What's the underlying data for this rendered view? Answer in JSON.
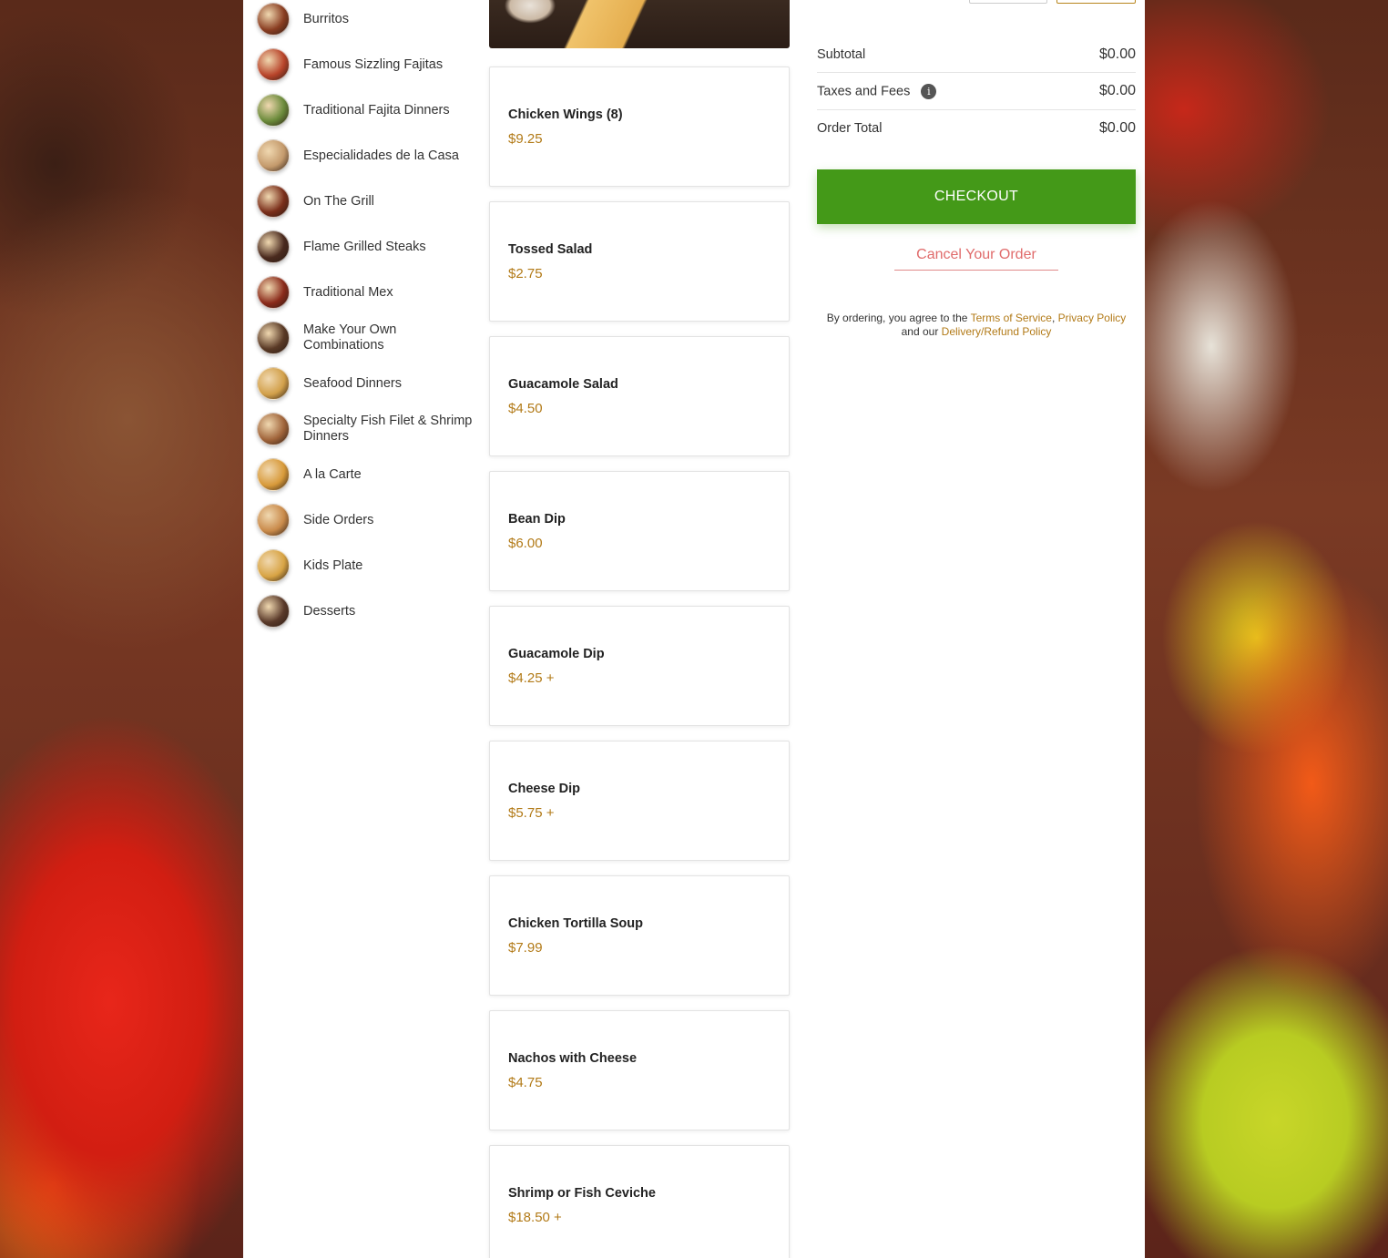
{
  "categories": [
    {
      "label": "Burritos",
      "thumb": "#8a3e22"
    },
    {
      "label": "Famous Sizzling Fajitas",
      "thumb": "#b8442a"
    },
    {
      "label": "Traditional Fajita Dinners",
      "thumb": "#6a8a3a"
    },
    {
      "label": "Especialidades de la Casa",
      "thumb": "#c49a6c"
    },
    {
      "label": "On The Grill",
      "thumb": "#7a2e1a"
    },
    {
      "label": "Flame Grilled Steaks",
      "thumb": "#4a2a1e"
    },
    {
      "label": "Traditional Mex",
      "thumb": "#8a2a1a"
    },
    {
      "label": "Make Your Own Combinations",
      "thumb": "#5a3a26"
    },
    {
      "label": "Seafood Dinners",
      "thumb": "#d2a04a"
    },
    {
      "label": "Specialty Fish Filet & Shrimp Dinners",
      "thumb": "#a0643a"
    },
    {
      "label": "A la Carte",
      "thumb": "#d89a3a"
    },
    {
      "label": "Side Orders",
      "thumb": "#c98a4a"
    },
    {
      "label": "Kids Plate",
      "thumb": "#d8a444"
    },
    {
      "label": "Desserts",
      "thumb": "#5a3a2a"
    }
  ],
  "menu_items": [
    {
      "name": "Chicken Wings (8)",
      "price": "$9.25"
    },
    {
      "name": "Tossed Salad",
      "price": "$2.75"
    },
    {
      "name": "Guacamole Salad",
      "price": "$4.50"
    },
    {
      "name": "Bean Dip",
      "price": "$6.00"
    },
    {
      "name": "Guacamole Dip",
      "price": "$4.25 +"
    },
    {
      "name": "Cheese Dip",
      "price": "$5.75 +"
    },
    {
      "name": "Chicken Tortilla Soup",
      "price": "$7.99"
    },
    {
      "name": "Nachos with Cheese",
      "price": "$4.75"
    },
    {
      "name": "Shrimp or Fish Ceviche",
      "price": "$18.50 +"
    }
  ],
  "summary": {
    "subtotal_label": "Subtotal",
    "subtotal_value": "$0.00",
    "taxes_label": "Taxes and Fees",
    "taxes_icon": "i",
    "taxes_value": "$0.00",
    "total_label": "Order Total",
    "total_value": "$0.00",
    "checkout_label": "CHECKOUT",
    "cancel_label": "Cancel Your Order"
  },
  "legal": {
    "prefix": "By ordering, you agree to the ",
    "terms": "Terms of Service",
    "sep1": ", ",
    "privacy": "Privacy Policy",
    "sep2": " and our ",
    "refund": "Delivery/Refund Policy"
  },
  "colors": {
    "accent": "#b27a17",
    "checkout": "#449918",
    "cancel": "#e06b6b"
  }
}
